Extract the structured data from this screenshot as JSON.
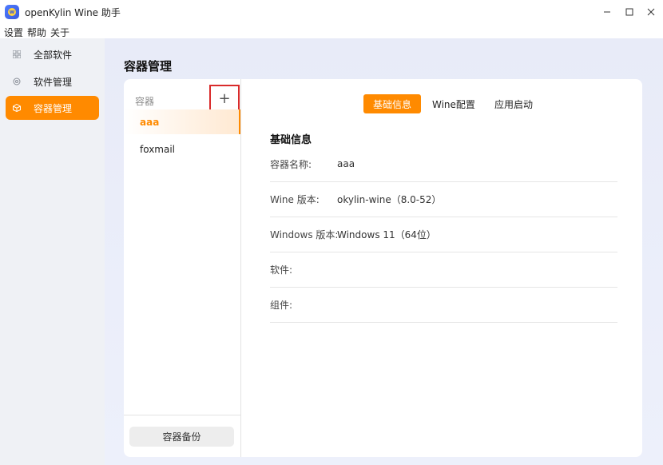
{
  "window": {
    "title": "openKylin Wine 助手",
    "controls": {
      "minimize": "–",
      "maximize": "□",
      "close": "✕"
    }
  },
  "menu": {
    "settings": "设置",
    "help": "帮助",
    "about": "关于"
  },
  "sidebar": {
    "items": [
      {
        "label": "全部软件",
        "icon": "grid-icon"
      },
      {
        "label": "软件管理",
        "icon": "gear-icon"
      },
      {
        "label": "容器管理",
        "icon": "box-icon",
        "active": true
      }
    ]
  },
  "page": {
    "title": "容器管理"
  },
  "containers": {
    "header": "容器",
    "add_symbol": "+",
    "items": [
      {
        "name": "aaa",
        "selected": true
      },
      {
        "name": "foxmail",
        "selected": false
      }
    ],
    "backup_label": "容器备份"
  },
  "tabs": [
    {
      "label": "基础信息",
      "active": true
    },
    {
      "label": "Wine配置",
      "active": false
    },
    {
      "label": "应用启动",
      "active": false
    }
  ],
  "basic_info": {
    "title": "基础信息",
    "rows": [
      {
        "label": "容器名称:",
        "value": "aaa"
      },
      {
        "label": "Wine 版本:",
        "value": "okylin-wine（8.0-52）"
      },
      {
        "label": "Windows 版本:",
        "value": "Windows 11（64位）"
      },
      {
        "label": "软件:",
        "value": ""
      },
      {
        "label": "组件:",
        "value": ""
      }
    ]
  },
  "colors": {
    "accent": "#ff8a00",
    "highlight_box": "#d92b2b"
  }
}
